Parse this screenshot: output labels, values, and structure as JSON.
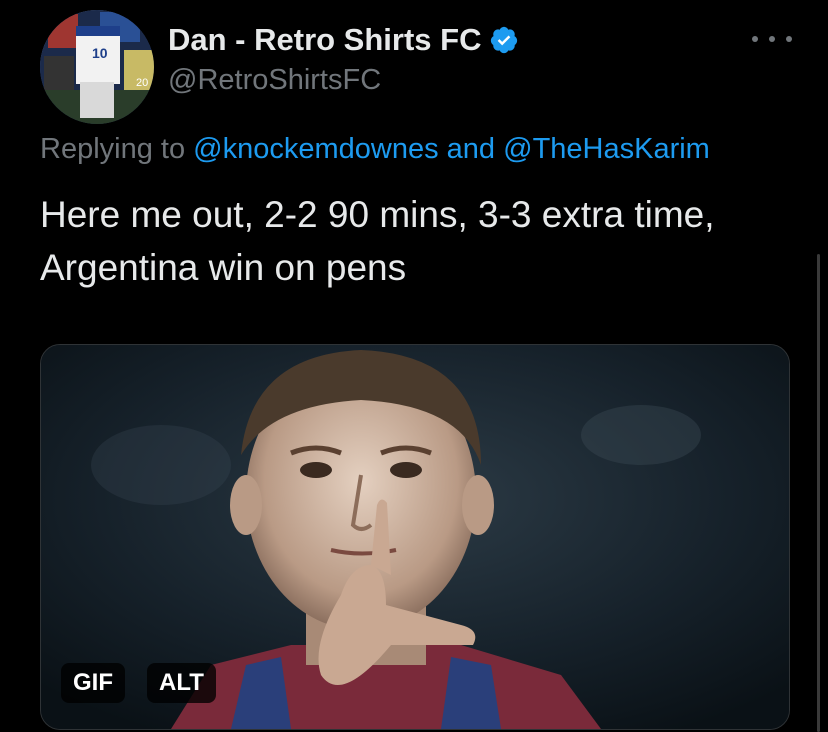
{
  "author": {
    "display_name": "Dan - Retro Shirts FC",
    "handle": "@RetroShirtsFC",
    "verified": true,
    "avatar_icon": "retro-shirts-avatar"
  },
  "reply": {
    "prefix": "Replying to",
    "mention1": "@knockemdownes",
    "joiner": "and",
    "mention2": "@TheHasKarim"
  },
  "tweet": {
    "text": "Here me out, 2-2 90 mins, 3-3 extra time, Argentina win on pens"
  },
  "media": {
    "type": "gif",
    "gif_badge": "GIF",
    "alt_badge": "ALT"
  },
  "colors": {
    "background": "#000000",
    "text": "#e7e9ea",
    "secondary": "#71767b",
    "accent": "#1d9bf0"
  }
}
